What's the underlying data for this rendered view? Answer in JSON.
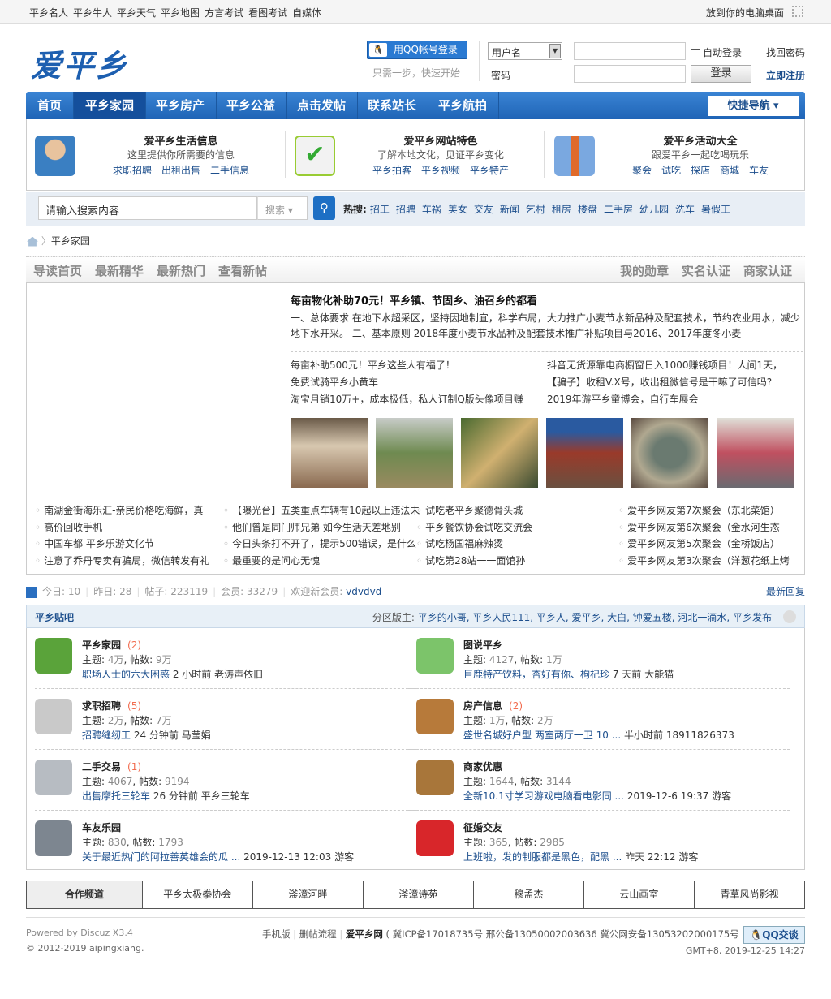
{
  "topbar": {
    "links": [
      "平乡名人",
      "平乡牛人",
      "平乡天气",
      "平乡地图",
      "方言考试",
      "看图考试",
      "自媒体"
    ],
    "desktop": "放到你的电脑桌面"
  },
  "logo": "爱平乡",
  "login": {
    "qq_button": "用QQ帐号登录",
    "qq_sub": "只需一步，快速开始",
    "user_type": "用户名",
    "password_label": "密码",
    "auto_login": "自动登录",
    "login_button": "登录",
    "find_password": "找回密码",
    "register": "立即注册"
  },
  "nav": {
    "items": [
      "首页",
      "平乡家园",
      "平乡房产",
      "平乡公益",
      "点击发帖",
      "联系站长",
      "平乡航拍"
    ],
    "active": 1,
    "quick": "快捷导航 ▾"
  },
  "features": [
    {
      "title": "爱平乡生活信息",
      "desc": "这里提供你所需要的信息",
      "links": [
        "求职招聘",
        "出租出售",
        "二手信息"
      ]
    },
    {
      "title": "爱平乡网站特色",
      "desc": "了解本地文化，见证平乡变化",
      "links": [
        "平乡拍客",
        "平乡视频",
        "平乡特产"
      ]
    },
    {
      "title": "爱平乡活动大全",
      "desc": "跟爱平乡一起吃喝玩乐",
      "links": [
        "聚会",
        "试吃",
        "探店",
        "商城",
        "车友"
      ]
    }
  ],
  "search": {
    "placeholder": "请输入搜索内容",
    "type": "搜索",
    "hot_label": "热搜:",
    "hot": [
      "招工",
      "招聘",
      "车祸",
      "美女",
      "交友",
      "新闻",
      "乞村",
      "租房",
      "楼盘",
      "二手房",
      "幼儿园",
      "洗车",
      "暑假工"
    ]
  },
  "breadcrumb": "平乡家园",
  "subnav": {
    "left": [
      "导读首页",
      "最新精华",
      "最新热门",
      "查看新帖"
    ],
    "right": [
      "我的勋章",
      "实名认证",
      "商家认证"
    ]
  },
  "headline": {
    "title": "每亩物化补助70元！平乡镇、节固乡、油召乡的都看",
    "summary": "一、总体要求 在地下水超采区，坚持因地制宜，科学布局，大力推广小麦节水新品种及配套技术，节约农业用水，减少地下水开采。 二、基本原则 2018年度小麦节水品种及配套技术推广补贴项目与2016、2017年度冬小麦"
  },
  "news_left": [
    "每亩补助500元！平乡这些人有福了！",
    "免费试骑平乡小黄车",
    "淘宝月销10万+，成本极低，私人订制Q版头像项目赚"
  ],
  "news_right": [
    "抖音无货源靠电商橱窗日入1000赚钱项目！人间1天，",
    "【骗子】收租V.X号，收出租微信号是干嘛了可信吗?",
    "2019年游平乡童博会，自行车展会"
  ],
  "lists": [
    [
      "南湖金街海乐汇-亲民价格吃海鲜，真",
      "高价回收手机",
      "中国车都 平乡乐游文化节",
      "注意了乔丹专卖有骗局，微信转发有礼"
    ],
    [
      "【曝光台】五类重点车辆有10起以上违法未",
      "他们曾是同门师兄弟 如今生活天差地别",
      "今日头条打不开了，提示500错误，是什么",
      "最重要的是问心无愧"
    ],
    [
      "试吃老平乡聚德骨头城",
      "平乡餐饮协会试吃交流会",
      "试吃杨国福麻辣烫",
      "试吃第28站一一面馆孙"
    ],
    [
      "爱平乡网友第7次聚会（东北菜馆）",
      "爱平乡网友第6次聚会（金水河生态",
      "爱平乡网友第5次聚会（金桥饭店）",
      "爱平乡网友第3次聚会（洋葱花纸上烤"
    ]
  ],
  "stats": {
    "today_label": "今日:",
    "today": "10",
    "yesterday_label": "昨日:",
    "yesterday": "28",
    "posts_label": "帖子:",
    "posts": "223119",
    "members_label": "会员:",
    "members": "33279",
    "welcome_label": "欢迎新会员:",
    "new_member": "vdvdvd",
    "latest_reply": "最新回复"
  },
  "section": {
    "title": "平乡贴吧",
    "moderators_label": "分区版主:",
    "moderators": "平乡的小哥, 平乡人民111, 平乡人, 爱平乡, 大白, 钟爱五楼, 河北一滴水, 平乡发布"
  },
  "forums": [
    {
      "name": "平乡家园",
      "new": "(2)",
      "topics": "4万",
      "posts": "9万",
      "last": "职场人士的六大困惑",
      "when": "2 小时前",
      "who": "老涛声依旧",
      "color": "#5aa33a"
    },
    {
      "name": "图说平乡",
      "new": "",
      "topics": "4127",
      "posts": "1万",
      "last": "巨鹿特产饮料，杏好有你、枸杞珍",
      "when": "7 天前",
      "who": "大能猫",
      "color": "#7cc46a"
    },
    {
      "name": "求职招聘",
      "new": "(5)",
      "topics": "2万",
      "posts": "7万",
      "last": "招聘缝纫工",
      "when": "24 分钟前",
      "who": "马莹娟",
      "color": "#c9c9c9"
    },
    {
      "name": "房产信息",
      "new": "(2)",
      "topics": "1万",
      "posts": "2万",
      "last": "盛世名城好户型 两室两厅一卫 10 ...",
      "when": "半小时前",
      "who": "18911826373",
      "color": "#b77a3a"
    },
    {
      "name": "二手交易",
      "new": "(1)",
      "topics": "4067",
      "posts": "9194",
      "last": "出售摩托三轮车",
      "when": "26 分钟前",
      "who": "平乡三轮车",
      "color": "#b7bcc2"
    },
    {
      "name": "商家优惠",
      "new": "",
      "topics": "1644",
      "posts": "3144",
      "last": "全新10.1寸学习游戏电脑看电影同 ...",
      "when": "2019-12-6 19:37",
      "who": "游客",
      "color": "#a8763a"
    },
    {
      "name": "车友乐园",
      "new": "",
      "topics": "830",
      "posts": "1793",
      "last": "关于最近热门的阿拉善英雄会的瓜 ...",
      "when": "2019-12-13 12:03",
      "who": "游客",
      "color": "#7d8690"
    },
    {
      "name": "征婚交友",
      "new": "",
      "topics": "365",
      "posts": "2985",
      "last": "上班啦，发的制服都是黑色，配黑 ...",
      "when": "昨天 22:12",
      "who": "游客",
      "color": "#d8262a"
    }
  ],
  "forum_labels": {
    "topics": "主题:",
    "posts": "帖数:"
  },
  "partners": [
    "合作频道",
    "平乡太极拳协会",
    "滏漳河畔",
    "滏漳诗苑",
    "穆孟杰",
    "云山画室",
    "青草风尚影视"
  ],
  "footer": {
    "powered": "Powered by Discuz X3.4",
    "copyright": "© 2012-2019 aipingxiang.",
    "links": [
      "手机版",
      "删帖流程",
      "爱平乡网"
    ],
    "icp": "( 冀ICP备17018735号 邢公备13050002003636 冀公网安备13053202000175号 )",
    "qq_talk": "QQ交谈",
    "time": "GMT+8, 2019-12-25 14:27"
  }
}
